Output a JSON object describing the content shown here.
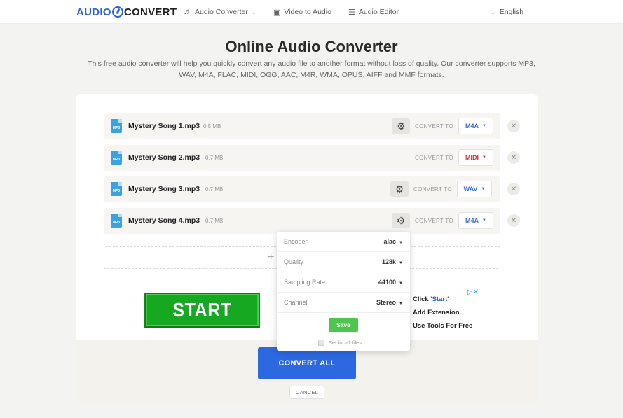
{
  "header": {
    "logo_left": "AUDIO",
    "logo_right": "CONVERT",
    "nav": [
      {
        "label": "Audio Converter",
        "icon": "music-note-icon"
      },
      {
        "label": "Video to Audio",
        "icon": "video-icon"
      },
      {
        "label": "Audio Editor",
        "icon": "sliders-icon"
      }
    ],
    "language": "English"
  },
  "hero": {
    "title": "Online Audio Converter",
    "subtitle": "This free audio converter will help you quickly convert any audio file to another format without loss of quality. Our converter supports MP3, WAV, M4A, FLAC, MIDI, OGG, AAC, M4R, WMA, OPUS, AIFF and MMF formats."
  },
  "files": [
    {
      "name": "Mystery Song 1.mp3",
      "size": "0.5 MB",
      "convert_label": "CONVERT TO",
      "format": "M4A",
      "format_color": "#2c68e0",
      "icon": "MP3"
    },
    {
      "name": "Mystery Song 2.mp3",
      "size": "0.7 MB",
      "convert_label": "CONVERT TO",
      "format": "MIDI",
      "format_color": "#d93030",
      "icon": "MP3"
    },
    {
      "name": "Mystery Song 3.mp3",
      "size": "0.7 MB",
      "convert_label": "CONVERT TO",
      "format": "WAV",
      "format_color": "#2c68e0",
      "icon": "MP3"
    },
    {
      "name": "Mystery Song 4.mp3",
      "size": "0.7 MB",
      "convert_label": "CONVERT TO",
      "format": "M4A",
      "format_color": "#2c68e0",
      "icon": "MP3"
    }
  ],
  "add_zone": {
    "plus": "+"
  },
  "ad": {
    "start_label": "START",
    "line1_prefix": "Click ",
    "line1_quote": "'Start'",
    "line2": "Add Extension",
    "line3": "Use Tools For Free",
    "badge": "▷✕"
  },
  "actions": {
    "convert_all": "CONVERT ALL",
    "cancel": "CANCEL"
  },
  "settings_popup": {
    "rows": [
      {
        "label": "Encoder",
        "value": "alac"
      },
      {
        "label": "Quality",
        "value": "128k"
      },
      {
        "label": "Sampling Rate",
        "value": "44100"
      },
      {
        "label": "Channel",
        "value": "Stereo"
      }
    ],
    "save": "Save",
    "set_all": "Set for all files"
  }
}
